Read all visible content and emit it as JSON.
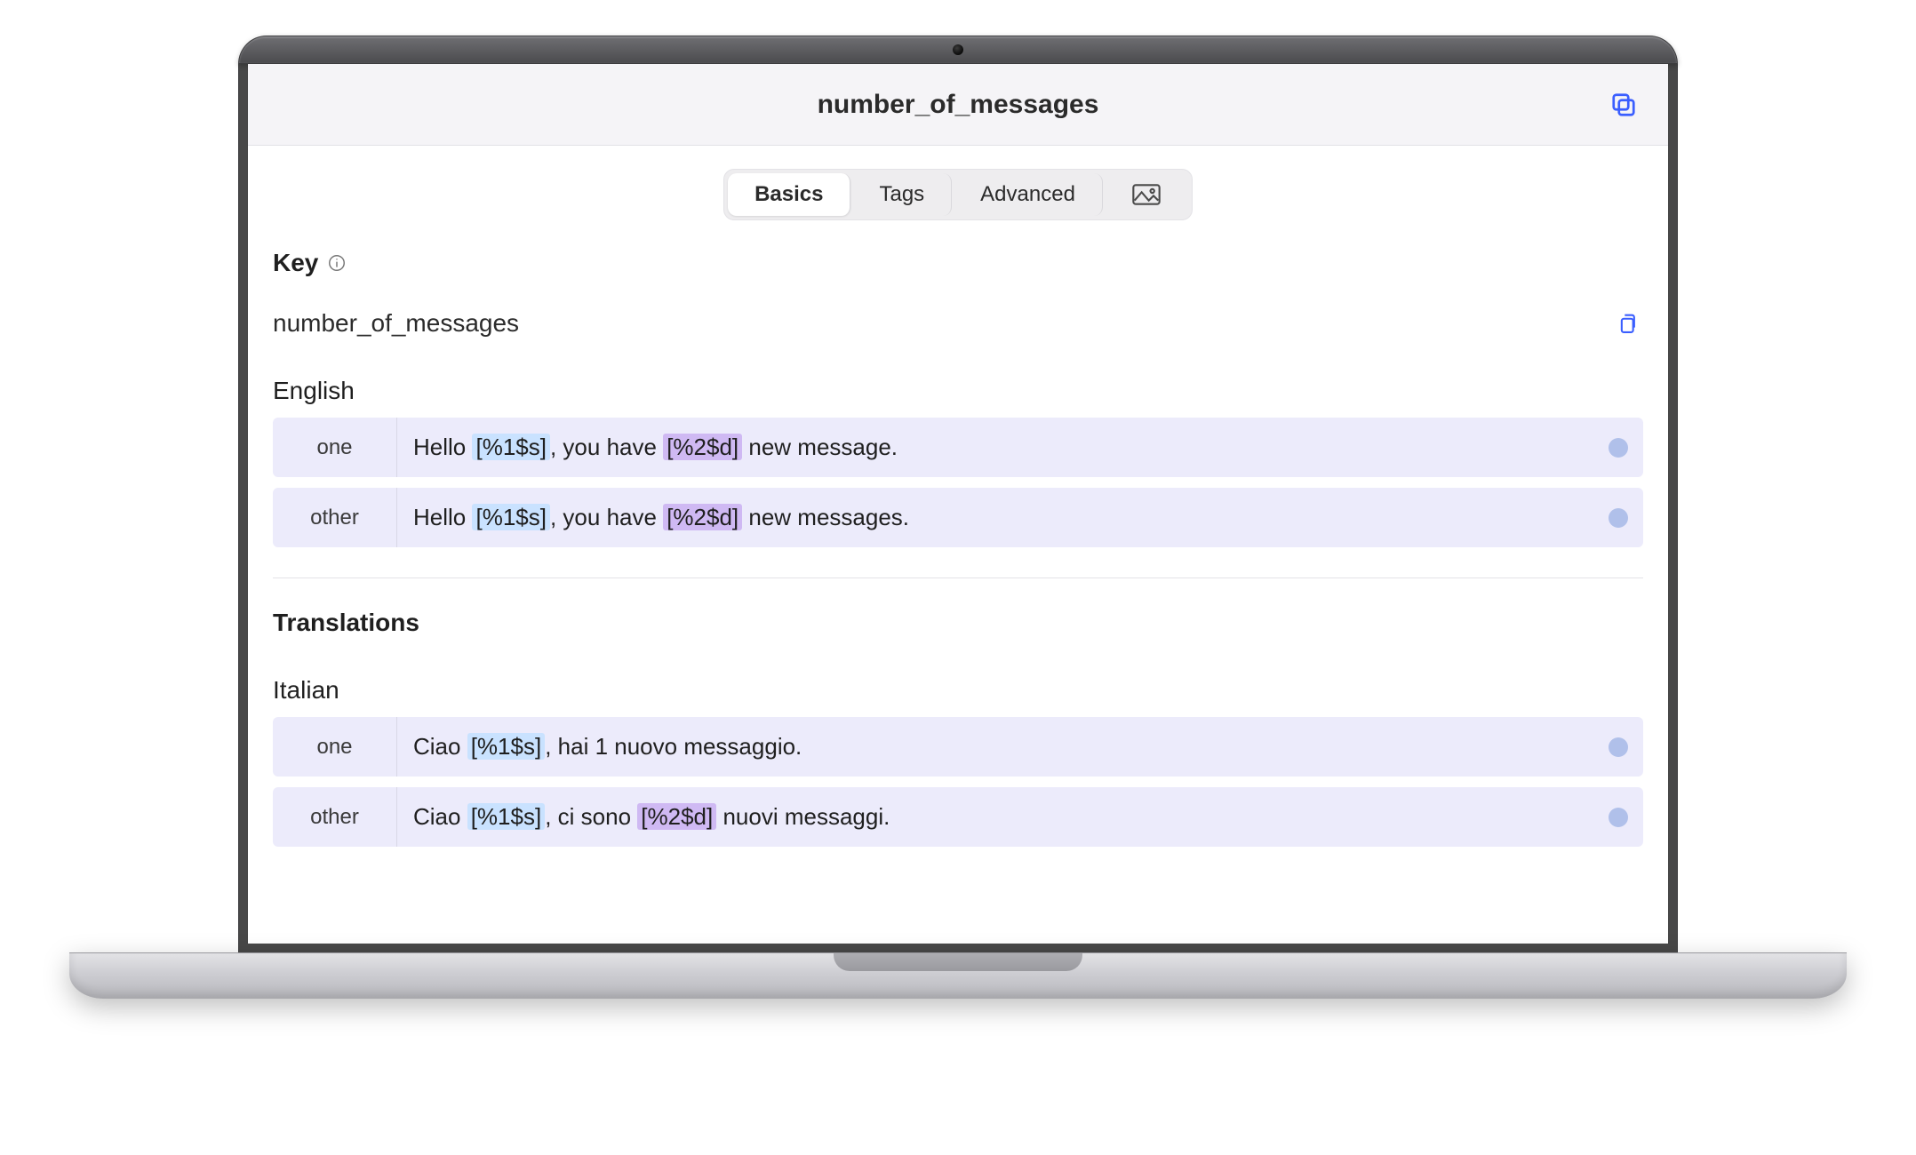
{
  "header": {
    "title": "number_of_messages"
  },
  "tabs": [
    {
      "label": "Basics",
      "active": true
    },
    {
      "label": "Tags",
      "active": false
    },
    {
      "label": "Advanced",
      "active": false
    }
  ],
  "key": {
    "label": "Key",
    "value": "number_of_messages"
  },
  "source": {
    "language": "English",
    "plurals": [
      {
        "category": "one",
        "parts": [
          {
            "type": "text",
            "value": "Hello "
          },
          {
            "type": "ph",
            "value": "[%1$s]",
            "style": "ph-1"
          },
          {
            "type": "text",
            "value": ", you have "
          },
          {
            "type": "ph",
            "value": "[%2$d]",
            "style": "ph-2"
          },
          {
            "type": "text",
            "value": " new message."
          }
        ]
      },
      {
        "category": "other",
        "parts": [
          {
            "type": "text",
            "value": "Hello "
          },
          {
            "type": "ph",
            "value": "[%1$s]",
            "style": "ph-1"
          },
          {
            "type": "text",
            "value": ", you have "
          },
          {
            "type": "ph",
            "value": "[%2$d]",
            "style": "ph-2"
          },
          {
            "type": "text",
            "value": " new messages."
          }
        ]
      }
    ]
  },
  "translations_label": "Translations",
  "translations": [
    {
      "language": "Italian",
      "plurals": [
        {
          "category": "one",
          "parts": [
            {
              "type": "text",
              "value": "Ciao "
            },
            {
              "type": "ph",
              "value": "[%1$s]",
              "style": "ph-1"
            },
            {
              "type": "text",
              "value": ", hai 1 nuovo messaggio."
            }
          ]
        },
        {
          "category": "other",
          "parts": [
            {
              "type": "text",
              "value": "Ciao "
            },
            {
              "type": "ph",
              "value": "[%1$s]",
              "style": "ph-1"
            },
            {
              "type": "text",
              "value": ", ci sono "
            },
            {
              "type": "ph",
              "value": "[%2$d]",
              "style": "ph-2"
            },
            {
              "type": "text",
              "value": " nuovi messaggi."
            }
          ]
        }
      ]
    }
  ]
}
